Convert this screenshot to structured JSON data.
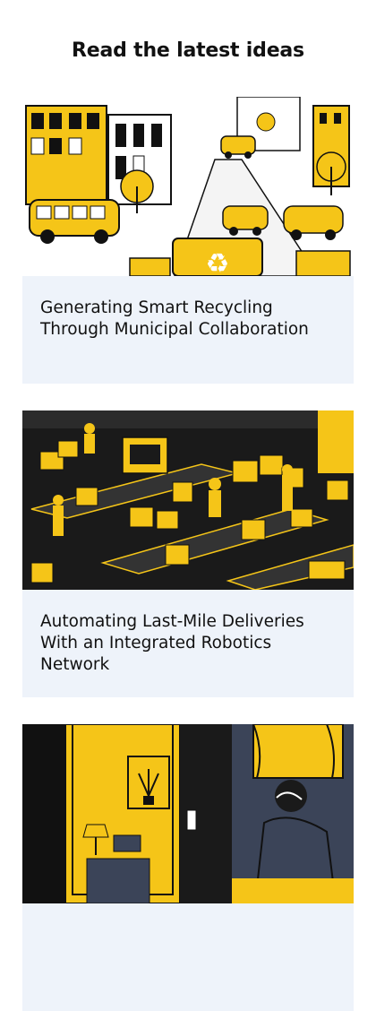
{
  "section": {
    "heading": "Read the latest ideas"
  },
  "articles": [
    {
      "title": "Generating Smart Recycling Through Municipal Collaboration",
      "image": "city-recycling-illustration"
    },
    {
      "title": "Automating Last-Mile Deliveries With an Integrated Robotics Network",
      "image": "warehouse-robotics-illustration"
    },
    {
      "title": "",
      "image": "interior-bedroom-illustration"
    }
  ],
  "colors": {
    "accent": "#f5c518",
    "dark": "#1a1a1a",
    "card_bg": "#eef3fa",
    "night": "#3b4458"
  }
}
